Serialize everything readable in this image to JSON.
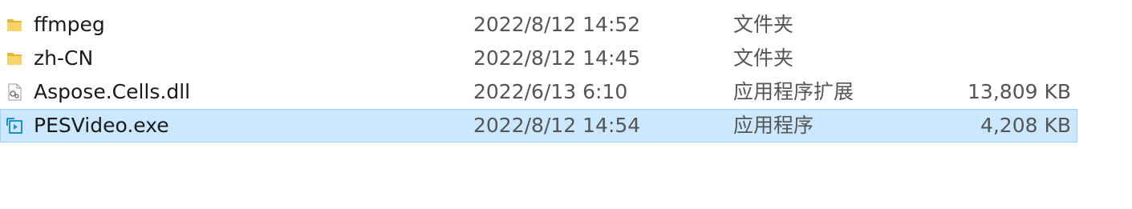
{
  "files": [
    {
      "name": "ffmpeg",
      "date": "2022/8/12 14:52",
      "type": "文件夹",
      "size": "",
      "icon": "folder-icon",
      "selected": false
    },
    {
      "name": "zh-CN",
      "date": "2022/8/12 14:45",
      "type": "文件夹",
      "size": "",
      "icon": "folder-icon",
      "selected": false
    },
    {
      "name": "Aspose.Cells.dll",
      "date": "2022/6/13 6:10",
      "type": "应用程序扩展",
      "size": "13,809 KB",
      "icon": "dll-file-icon",
      "selected": false
    },
    {
      "name": "PESVideo.exe",
      "date": "2022/8/12 14:54",
      "type": "应用程序",
      "size": "4,208 KB",
      "icon": "exe-app-icon",
      "selected": true
    }
  ],
  "colors": {
    "selection_bg": "#cce8ff",
    "selection_border": "#99d1ff",
    "folder": "#f5c342",
    "exe_icon": "#1e90d6"
  }
}
